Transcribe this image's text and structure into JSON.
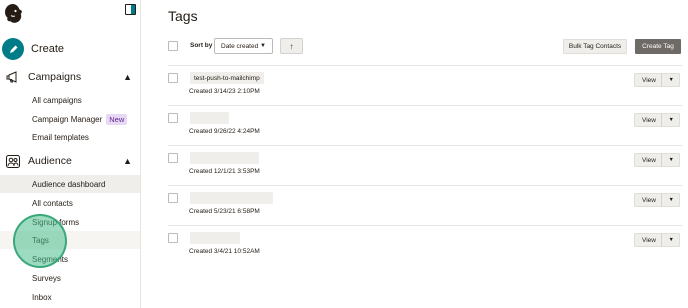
{
  "sidebar": {
    "create_label": "Create",
    "campaigns": {
      "label": "Campaigns",
      "items": [
        "All campaigns",
        "Campaign Manager",
        "Email templates"
      ],
      "new_badge": "New"
    },
    "audience": {
      "label": "Audience",
      "items": [
        "Audience dashboard",
        "All contacts",
        "Signup forms",
        "Tags",
        "Segments",
        "Surveys",
        "Inbox"
      ]
    }
  },
  "main": {
    "title": "Tags",
    "toolbar": {
      "sort_by_label": "Sort by",
      "sort_value": "Date created",
      "bulk_button": "Bulk Tag Contacts",
      "create_button": "Create Tag"
    },
    "rows": [
      {
        "name": "test-push-to-mailchimp",
        "created": "Created 3/14/23 2:10PM"
      },
      {
        "name": "",
        "created": "Created 9/26/22 4:24PM"
      },
      {
        "name": "",
        "created": "Created 12/1/21 3:53PM"
      },
      {
        "name": "",
        "created": "Created 5/23/21 6:58PM"
      },
      {
        "name": "",
        "created": "Created 3/4/21 10:52AM"
      }
    ],
    "view_label": "View"
  },
  "colors": {
    "accent": "#007c89",
    "create_tag_bg": "#6e6b67",
    "new_badge_bg": "#e8d8f6",
    "active_nav_bg": "#efeeea"
  },
  "icons": {
    "logo": "mailchimp-freddie-icon",
    "collapse": "sidebar-collapse-icon",
    "create": "pencil-icon",
    "campaigns": "megaphone-icon",
    "audience": "people-icon",
    "sort_direction": "arrow-up-icon"
  }
}
